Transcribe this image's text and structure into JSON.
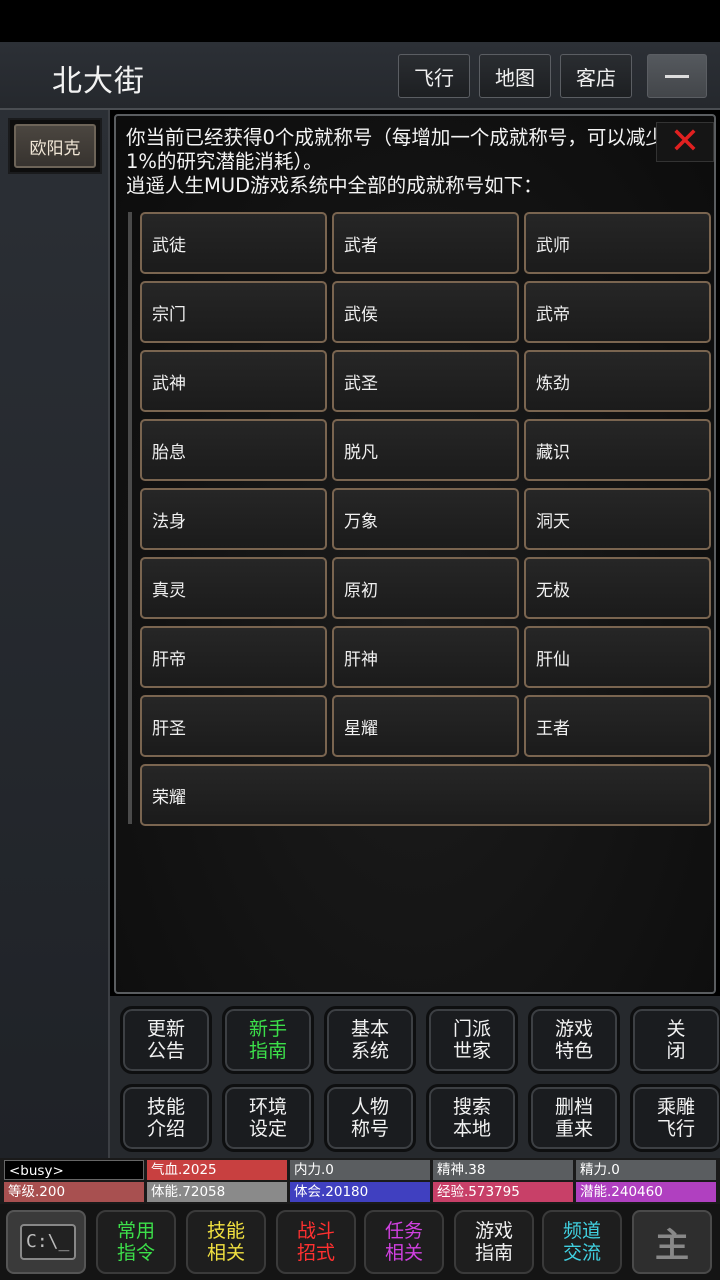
{
  "header": {
    "location": "北大街",
    "buttons": [
      "飞行",
      "地图",
      "客店"
    ]
  },
  "sidebar": {
    "npc": "欧阳克"
  },
  "panel": {
    "intro_line1": "你当前已经获得0个成就称号（每增加一个成就称号，可以减少1%的研究潜能消耗）。",
    "intro_line2": "逍遥人生MUD游戏系统中全部的成就称号如下：",
    "titles": [
      "武徒",
      "武者",
      "武师",
      "宗门",
      "武侯",
      "武帝",
      "武神",
      "武圣",
      "炼劲",
      "胎息",
      "脱凡",
      "藏识",
      "法身",
      "万象",
      "洞天",
      "真灵",
      "原初",
      "无极",
      "肝帝",
      "肝神",
      "肝仙",
      "肝圣",
      "星耀",
      "王者",
      "荣耀"
    ]
  },
  "commands": [
    {
      "l1": "更新",
      "l2": "公告"
    },
    {
      "l1": "新手",
      "l2": "指南",
      "color": "#3ce04a"
    },
    {
      "l1": "基本",
      "l2": "系统"
    },
    {
      "l1": "门派",
      "l2": "世家"
    },
    {
      "l1": "游戏",
      "l2": "特色"
    },
    {
      "l1": "关",
      "l2": "闭"
    },
    {
      "l1": "技能",
      "l2": "介绍"
    },
    {
      "l1": "环境",
      "l2": "设定"
    },
    {
      "l1": "人物",
      "l2": "称号"
    },
    {
      "l1": "搜索",
      "l2": "本地"
    },
    {
      "l1": "删档",
      "l2": "重来"
    },
    {
      "l1": "乘雕",
      "l2": "飞行"
    }
  ],
  "status": [
    {
      "text": "<busy>",
      "color": "#000000"
    },
    {
      "text": "气血.2025",
      "color": "#c84040"
    },
    {
      "text": "内力.0",
      "color": "#5a5d60"
    },
    {
      "text": "精神.38",
      "color": "#5a5d60"
    },
    {
      "text": "精力.0",
      "color": "#5a5d60"
    },
    {
      "text": "等级.200",
      "color": "#a85050"
    },
    {
      "text": "体能.72058",
      "color": "#8a8a8a"
    },
    {
      "text": "体会.20180",
      "color": "#4040c0"
    },
    {
      "text": "经验.573795",
      "color": "#c84068"
    },
    {
      "text": "潜能.240460",
      "color": "#b040c0"
    }
  ],
  "bottom": {
    "cmd_icon": "C:\\_",
    "buttons": [
      {
        "l1": "常用",
        "l2": "指令",
        "color": "#3ce04a"
      },
      {
        "l1": "技能",
        "l2": "相关",
        "color": "#f0e040"
      },
      {
        "l1": "战斗",
        "l2": "招式",
        "color": "#ff3030"
      },
      {
        "l1": "任务",
        "l2": "相关",
        "color": "#d040e0"
      },
      {
        "l1": "游戏",
        "l2": "指南",
        "color": "#f0f0f0"
      },
      {
        "l1": "频道",
        "l2": "交流",
        "color": "#40d0e0"
      }
    ],
    "misc_icon": "主"
  }
}
